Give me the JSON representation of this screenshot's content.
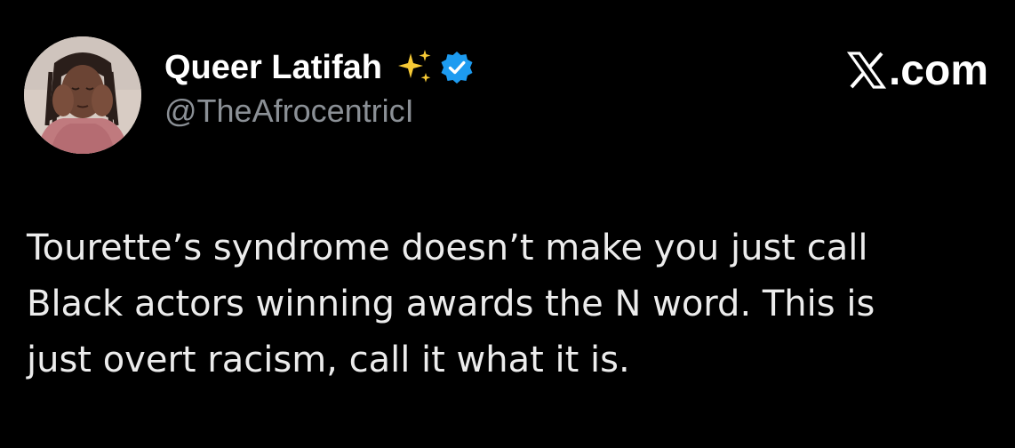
{
  "author": {
    "display_name": "Queer Latifah",
    "handle": "@TheAfrocentricI",
    "emoji_icon": "sparkles-icon",
    "verified_icon": "verified-badge-icon",
    "verified_color": "#1d9bf0"
  },
  "brand": {
    "logo_icon": "x-logo-icon",
    "text": ".com"
  },
  "tweet": {
    "text": "Tourette’s syndrome doesn’t make you just call\nBlack actors winning awards the N word. This is\njust overt racism, call it what it is."
  },
  "colors": {
    "background": "#000000",
    "text": "#e7e9ea",
    "handle": "#8b9096"
  }
}
